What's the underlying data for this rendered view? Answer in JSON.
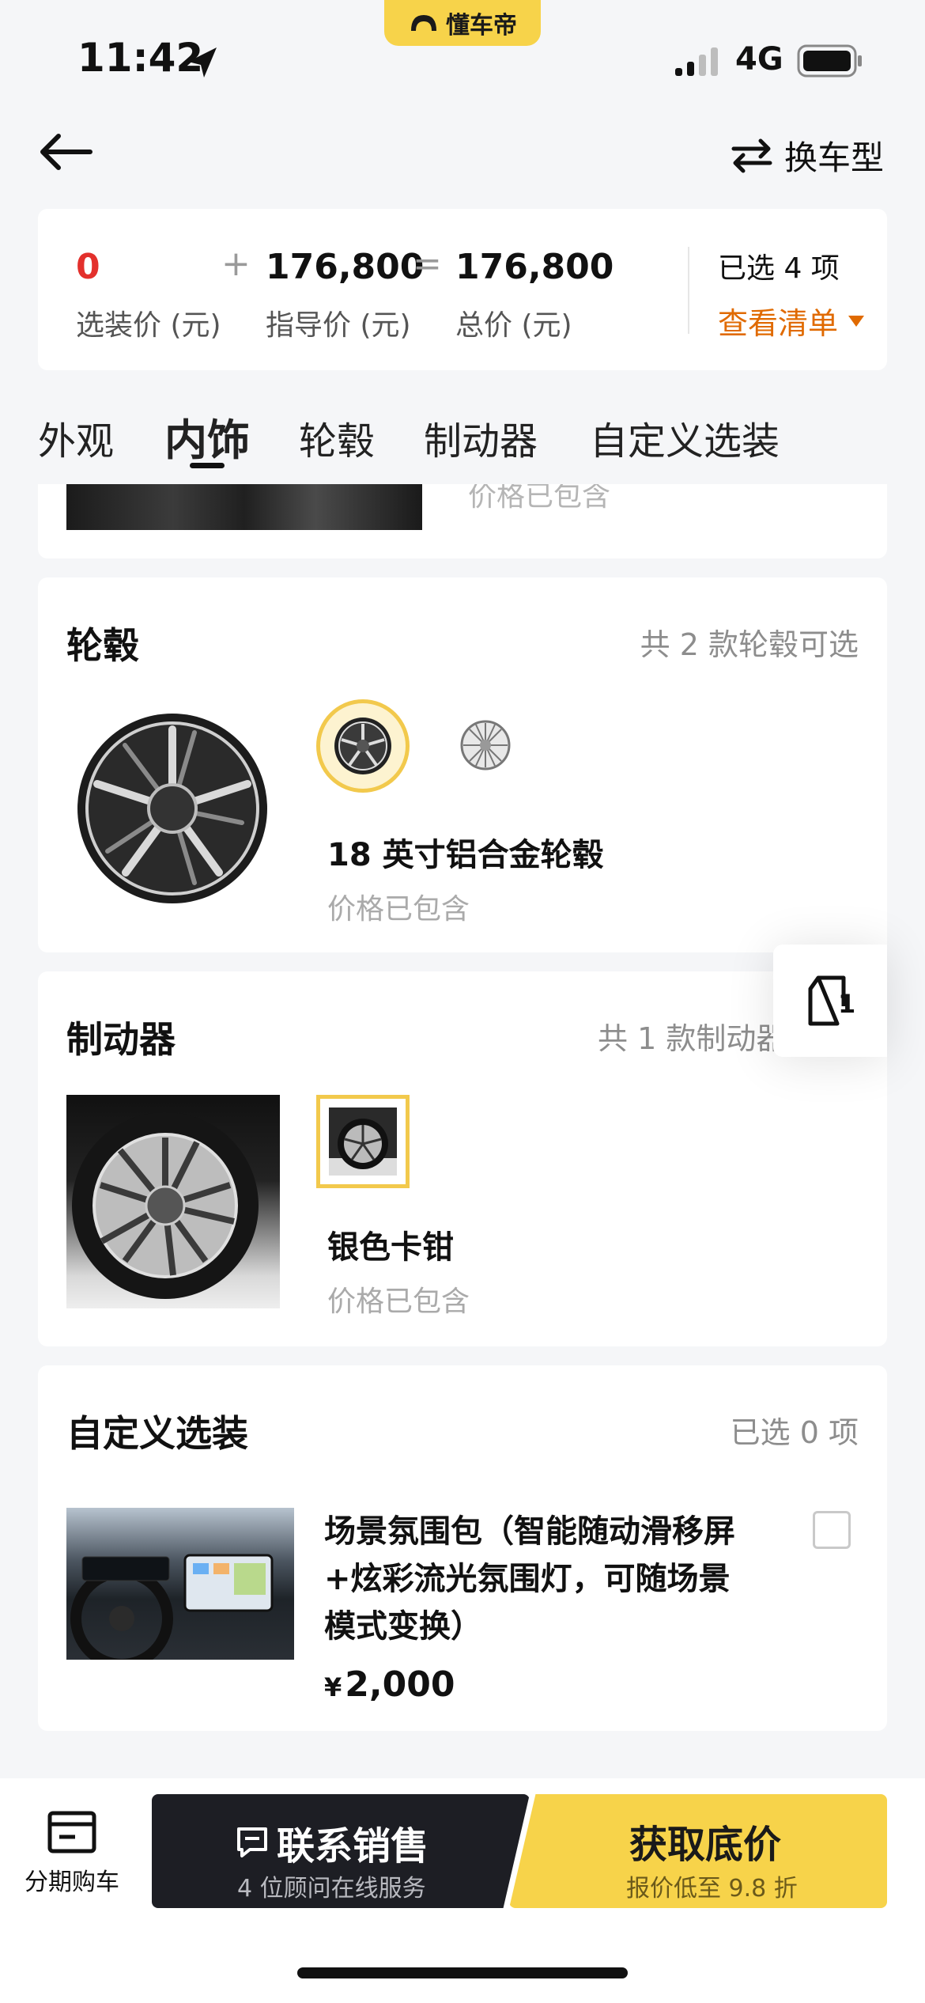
{
  "status_bar": {
    "time": "11:42",
    "network": "4G"
  },
  "brand_pill": {
    "label": "懂车帝"
  },
  "header": {
    "switch_label": "换车型"
  },
  "price_bar": {
    "option_price": "0",
    "option_price_label": "选装价 (元)",
    "guide_price": "176,800",
    "guide_price_label": "指导价 (元)",
    "total_price": "176,800",
    "total_price_label": "总价 (元)",
    "plus": "+",
    "equals": "=",
    "selected_count": "已选 4 项",
    "view_list": "查看清单",
    "colors": {
      "accent": "#e06a00",
      "price_zero": "#e3302c"
    }
  },
  "tabs": [
    {
      "label": "外观",
      "active": false
    },
    {
      "label": "内饰",
      "active": true
    },
    {
      "label": "轮毂",
      "active": false
    },
    {
      "label": "制动器",
      "active": false
    },
    {
      "label": "自定义选装",
      "active": false
    }
  ],
  "interior_partial": {
    "included": "价格已包含"
  },
  "wheels": {
    "title": "轮毂",
    "count": "共 2 款轮毂可选",
    "selected_name": "18 英寸铝合金轮毂",
    "included": "价格已包含"
  },
  "floating_button": {
    "badge": "1"
  },
  "brakes": {
    "title": "制动器",
    "count": "共 1 款制动器",
    "selected_name": "银色卡钳",
    "included": "价格已包含"
  },
  "custom": {
    "title": "自定义选装",
    "selected_count": "已选 0 项",
    "items": [
      {
        "name": "场景氛围包（智能随动滑移屏+炫彩流光氛围灯，可随场景模式变换）",
        "name_line1": "场景氛围包（智能随动滑移屏",
        "name_line2": "+炫彩流光氛围灯，可随场景",
        "name_line3": "模式变换）",
        "currency": "¥",
        "price": "2,000",
        "checked": false
      }
    ]
  },
  "bottom": {
    "installment_label": "分期购车",
    "contact_title": "联系销售",
    "contact_sub": "4 位顾问在线服务",
    "quote_title": "获取底价",
    "quote_sub": "报价低至 9.8 折",
    "colors": {
      "dark": "#1d1e24",
      "yellow": "#f7d34a"
    }
  }
}
